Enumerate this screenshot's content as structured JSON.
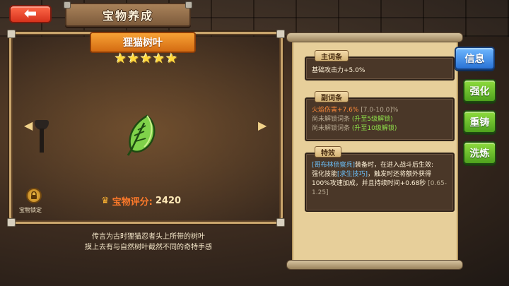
{
  "header": {
    "back_glyph": "⬅",
    "title": "宝物养成"
  },
  "treasure": {
    "name": "狸猫树叶",
    "stars": 5,
    "star_glyph": "★",
    "icon": "leaf-icon",
    "score_label": "宝物评分:",
    "score_value": "2420",
    "lock_label": "宝物锁定",
    "description_line1": "传言为古时狸猫忍者头上所带的树叶",
    "description_line2": "摸上去有与自然树叶截然不同的奇特手感"
  },
  "panel": {
    "main_affix": {
      "tag": "主词条",
      "line": "基础攻击力+5.0%"
    },
    "sub_affix": {
      "tag": "副词条",
      "line1_attr": "火焰伤害+7.6%",
      "line1_range": "[7.0-10.0]",
      "line1_suffix": "%",
      "line2_text": "尚未解锁词条",
      "line2_unlock": "(升至5级解锁)",
      "line3_text": "尚未解锁词条",
      "line3_unlock": "(升至10级解锁)"
    },
    "special": {
      "tag": "特效",
      "hero_tag": "[哥布林侦察兵]",
      "text1": "装备时，在进入战斗后生效:",
      "text2_prefix": "强化技能",
      "skill_tag": "[求生技巧]",
      "text2_suffix": "，触发时还将额外获得100%攻速加成，并且持续时间+0.68秒",
      "range": "[0.65-1.25]"
    }
  },
  "tabs": [
    {
      "label": "信息",
      "active": true
    },
    {
      "label": "强化",
      "active": false
    },
    {
      "label": "重铸",
      "active": false
    },
    {
      "label": "洗炼",
      "active": false
    }
  ],
  "colors": {
    "accent_orange": "#ff8a3a",
    "unlock_green": "#8fe04a",
    "tag_blue": "#6cc3ff",
    "tab_green": "#4ea11d",
    "tab_blue": "#2a73d6"
  }
}
